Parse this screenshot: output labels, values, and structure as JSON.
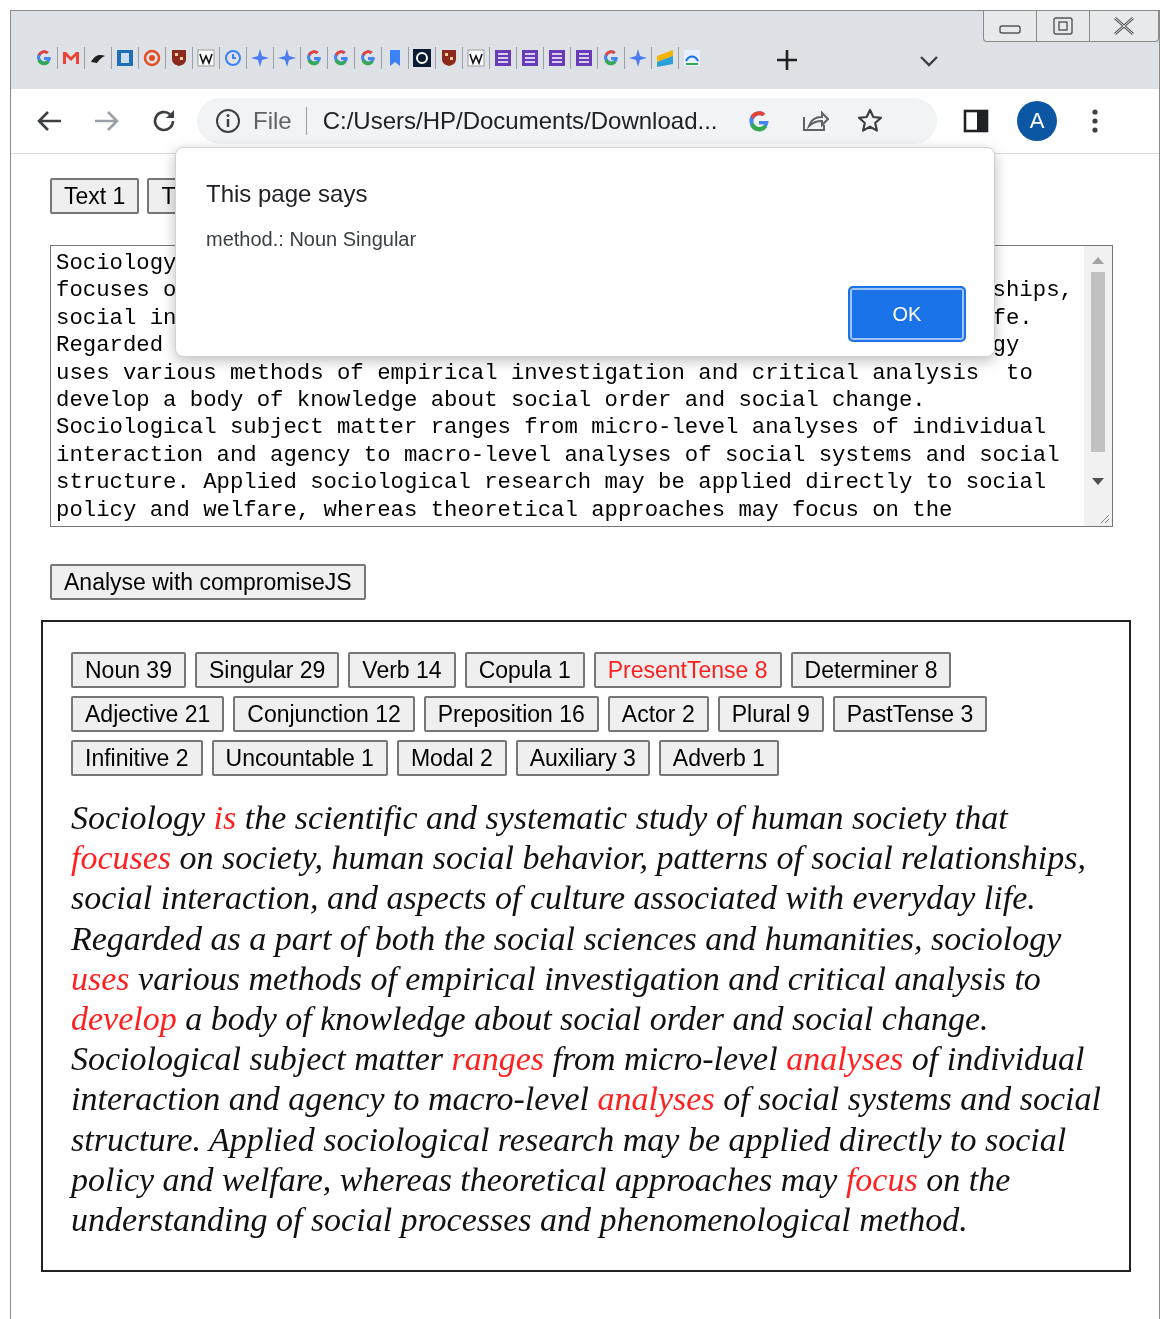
{
  "browser": {
    "address_scheme": "File",
    "address": "C:/Users/HP/Documents/Download...",
    "profile_initial": "A"
  },
  "text_buttons": [
    "Text 1",
    "T"
  ],
  "textarea_lines": [
    {
      "text": "Sociology"
    },
    {
      "text": "focuses o",
      "tail": "ships,"
    },
    {
      "text": "social in",
      "tail": "fe."
    },
    {
      "text": "Regarded",
      "tail": "gy"
    },
    {
      "text": "uses various methods of empirical investigation and critical analysis  to"
    },
    {
      "text": "develop a body of knowledge about social order and social change."
    },
    {
      "text": "Sociological subject matter ranges from micro-level analyses of individual"
    },
    {
      "text": "interaction and agency to macro-level analyses of social systems and social"
    },
    {
      "text": "structure. Applied sociological research may be applied directly to social"
    },
    {
      "text": "policy and welfare, whereas theoretical approaches may focus on the"
    }
  ],
  "analyse_button": "Analyse with compromiseJS",
  "tags": [
    {
      "label": "Noun 39",
      "selected": false
    },
    {
      "label": "Singular 29",
      "selected": false
    },
    {
      "label": "Verb 14",
      "selected": false
    },
    {
      "label": "Copula 1",
      "selected": false
    },
    {
      "label": "PresentTense 8",
      "selected": true
    },
    {
      "label": "Determiner 8",
      "selected": false
    },
    {
      "label": "Adjective 21",
      "selected": false
    },
    {
      "label": "Conjunction 12",
      "selected": false
    },
    {
      "label": "Preposition 16",
      "selected": false
    },
    {
      "label": "Actor 2",
      "selected": false
    },
    {
      "label": "Plural 9",
      "selected": false
    },
    {
      "label": "PastTense 3",
      "selected": false
    },
    {
      "label": "Infinitive 2",
      "selected": false
    },
    {
      "label": "Uncountable 1",
      "selected": false
    },
    {
      "label": "Modal 2",
      "selected": false
    },
    {
      "label": "Auxiliary 3",
      "selected": false
    },
    {
      "label": "Adverb 1",
      "selected": false
    }
  ],
  "analysed_text": [
    {
      "text": "Sociology ",
      "highlighted": false
    },
    {
      "text": "is",
      "highlighted": true
    },
    {
      "text": " the scientific and systematic study of human society that ",
      "highlighted": false
    },
    {
      "text": "focuses",
      "highlighted": true
    },
    {
      "text": " on society, human social behavior, patterns of social relationships, social interaction, and aspects of culture associated with everyday life. Regarded as a part of both the social sciences and humanities, sociology ",
      "highlighted": false
    },
    {
      "text": "uses",
      "highlighted": true
    },
    {
      "text": " various methods of empirical investigation and critical analysis to ",
      "highlighted": false
    },
    {
      "text": "develop",
      "highlighted": true
    },
    {
      "text": " a body of knowledge about social order and social change. Sociological subject matter ",
      "highlighted": false
    },
    {
      "text": "ranges",
      "highlighted": true
    },
    {
      "text": " from micro-level ",
      "highlighted": false
    },
    {
      "text": "analyses",
      "highlighted": true
    },
    {
      "text": " of individual interaction and agency to macro-level ",
      "highlighted": false
    },
    {
      "text": "analyses",
      "highlighted": true
    },
    {
      "text": " of social systems and social structure. Applied sociological research may be applied directly to social policy and welfare, whereas theoretical approaches may ",
      "highlighted": false
    },
    {
      "text": "focus",
      "highlighted": true
    },
    {
      "text": " on the understanding of social processes and phenomenological method.",
      "highlighted": false
    }
  ],
  "dialog": {
    "title": "This page says",
    "message": "method.: Noun Singular",
    "button": "OK"
  }
}
